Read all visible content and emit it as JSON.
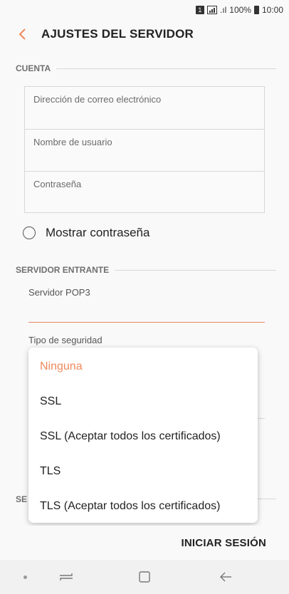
{
  "status_bar": {
    "sim_label": "1",
    "signal_text": ".ıl",
    "battery": "100%",
    "time": "10:00"
  },
  "header": {
    "title": "AJUSTES DEL SERVIDOR",
    "back_icon": "chevron-left-icon",
    "accent_color": "#ef8a5c"
  },
  "cuenta": {
    "section_label": "CUENTA",
    "email_placeholder": "Dirección de correo electrónico",
    "username_placeholder": "Nombre de usuario",
    "password_placeholder": "Contraseña",
    "show_password_label": "Mostrar contraseña"
  },
  "incoming": {
    "section_label": "SERVIDOR ENTRANTE",
    "pop3_label": "Servidor POP3",
    "pop3_value": "",
    "security_label": "Tipo de seguridad",
    "clipped_section_text": "SE"
  },
  "security_dropdown": {
    "selected": "Ninguna",
    "options": [
      "Ninguna",
      "SSL",
      "SSL (Aceptar todos los certificados)",
      "TLS",
      "TLS (Aceptar todos los certificados)"
    ]
  },
  "footer": {
    "signin_label": "INICIAR SESIÓN"
  },
  "nav_bar": {
    "recent_icon": "recent-apps-icon",
    "home_icon": "home-icon",
    "back_icon": "back-arrow-icon"
  }
}
